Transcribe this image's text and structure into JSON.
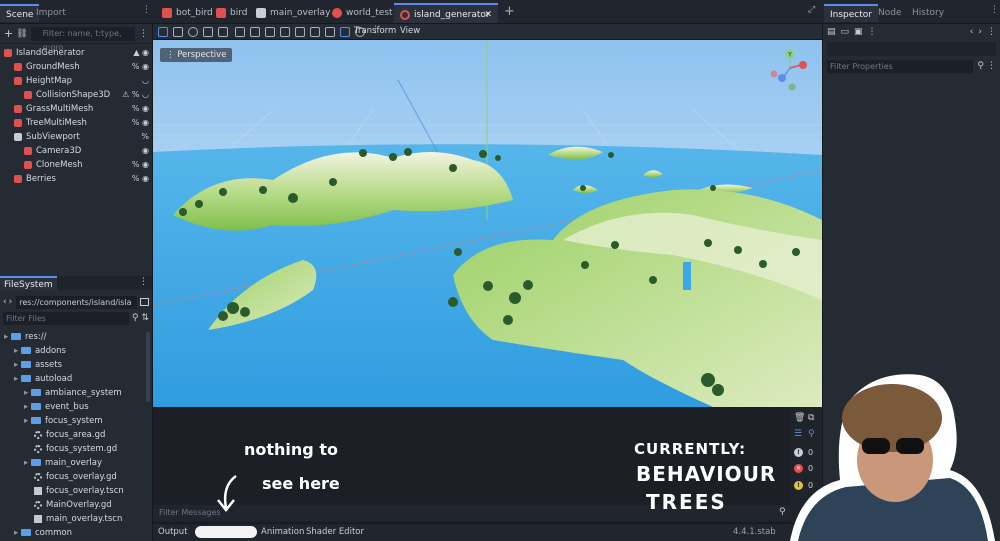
{
  "top_bar": {
    "left_tabs": [
      "Scene",
      "Import"
    ],
    "scene_tabs": [
      "bot_bird",
      "bird",
      "main_overlay",
      "world_test",
      "island_generator"
    ],
    "active_scene_tab": "island_generator",
    "add_tab_label": "+",
    "right_tabs": [
      "Inspector",
      "Node",
      "History"
    ]
  },
  "scene_dock": {
    "filter_placeholder": "Filter: name, t:type, g:gro",
    "nodes": [
      {
        "label": "IslandGenerator",
        "indent": 0,
        "color": "#e0504e",
        "icons": "▲ ◉"
      },
      {
        "label": "GroundMesh",
        "indent": 1,
        "color": "#e0504e",
        "icons": "% ◉"
      },
      {
        "label": "HeightMap",
        "indent": 1,
        "color": "#e0504e",
        "icons": "◡"
      },
      {
        "label": "CollisionShape3D",
        "indent": 2,
        "color": "#e0504e",
        "icons": "⚠ % ◡"
      },
      {
        "label": "GrassMultiMesh",
        "indent": 1,
        "color": "#e0504e",
        "icons": "% ◉"
      },
      {
        "label": "TreeMultiMesh",
        "indent": 1,
        "color": "#e0504e",
        "icons": "% ◉"
      },
      {
        "label": "SubViewport",
        "indent": 1,
        "color": "#c9ced6",
        "icons": "%"
      },
      {
        "label": "Camera3D",
        "indent": 2,
        "color": "#e0504e",
        "icons": "◉"
      },
      {
        "label": "CloneMesh",
        "indent": 2,
        "color": "#e0504e",
        "icons": "% ◉"
      },
      {
        "label": "Berries",
        "indent": 1,
        "color": "#e0504e",
        "icons": "% ◉"
      }
    ]
  },
  "filesystem": {
    "title": "FileSystem",
    "path": "res://components/island/isla",
    "filter_placeholder": "Filter Files",
    "items": [
      {
        "label": "res://",
        "indent": 0,
        "kind": "folder"
      },
      {
        "label": "addons",
        "indent": 1,
        "kind": "folder"
      },
      {
        "label": "assets",
        "indent": 1,
        "kind": "folder"
      },
      {
        "label": "autoload",
        "indent": 1,
        "kind": "folder"
      },
      {
        "label": "ambiance_system",
        "indent": 2,
        "kind": "folder"
      },
      {
        "label": "event_bus",
        "indent": 2,
        "kind": "folder"
      },
      {
        "label": "focus_system",
        "indent": 2,
        "kind": "folder"
      },
      {
        "label": "focus_area.gd",
        "indent": 3,
        "kind": "script"
      },
      {
        "label": "focus_system.gd",
        "indent": 3,
        "kind": "script"
      },
      {
        "label": "main_overlay",
        "indent": 2,
        "kind": "folder"
      },
      {
        "label": "focus_overlay.gd",
        "indent": 3,
        "kind": "script"
      },
      {
        "label": "focus_overlay.tscn",
        "indent": 3,
        "kind": "scene"
      },
      {
        "label": "MainOverlay.gd",
        "indent": 3,
        "kind": "script"
      },
      {
        "label": "main_overlay.tscn",
        "indent": 3,
        "kind": "scene"
      },
      {
        "label": "common",
        "indent": 1,
        "kind": "folder"
      }
    ]
  },
  "toolbar": {
    "transform_label": "Transform",
    "view_label": "View"
  },
  "viewport": {
    "perspective_label": "Perspective",
    "gizmo_y_label": "Y"
  },
  "output": {
    "filter_placeholder": "Filter Messages",
    "counts": {
      "messages": "0",
      "errors": "0",
      "warnings": "0"
    },
    "tabs": [
      "Output",
      "Animation",
      "Shader Editor"
    ],
    "version": "4.4.1.stab"
  },
  "overlay": {
    "note_line1": "nothing to",
    "note_line2": "see here",
    "currently_label": "CURRENTLY:",
    "topic_line1": "BEHAVIOUR",
    "topic_line2": "TREES"
  },
  "inspector": {
    "filter_placeholder": "Filter Properties"
  },
  "colors": {
    "accent": "#5c8ee6",
    "sky": "#a9d2f4",
    "sea": "#4aa8e6",
    "grass": "#8cc654",
    "tree": "#2c5a2c"
  }
}
